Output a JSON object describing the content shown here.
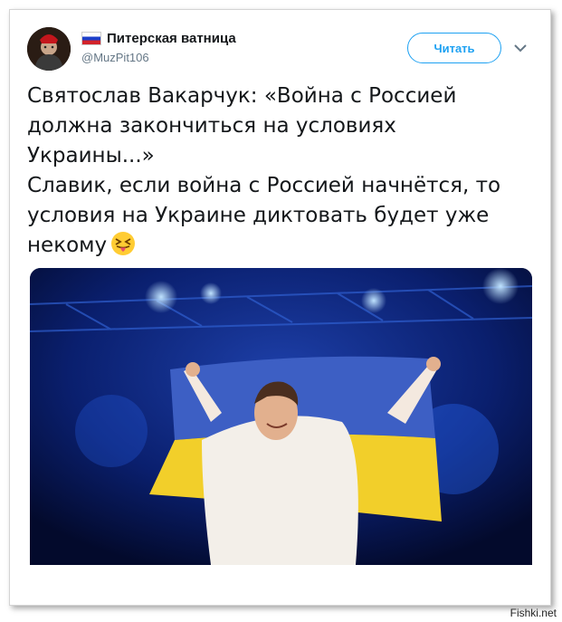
{
  "author": {
    "name": "Питерская ватница",
    "handle": "@MuzPit106",
    "flag_icon": "russia-flag-icon"
  },
  "follow_button": {
    "label": "Читать"
  },
  "menu_icon": "chevron-down-icon",
  "tweet": {
    "paragraph1": "Святослав Вакарчук: «Война с Россией\nдолжна закончиться на условиях\nУкраины...»",
    "paragraph2": "Славик, если война с Россией начнётся, то\nусловия на Украине диктовать будет уже\nнекому",
    "emoji": "squinting-face-with-tongue-emoji"
  },
  "media": {
    "image_icon": "concert-photo-image"
  },
  "watermark": "Fishki.net",
  "colors": {
    "accent": "#1da1f2",
    "text": "#14171a",
    "muted": "#657786",
    "flag_blue": "#2a55b8",
    "flag_yellow": "#f2cf2a"
  }
}
